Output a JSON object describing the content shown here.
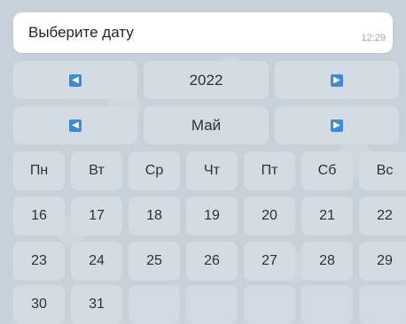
{
  "message": {
    "text": "Выберите дату",
    "time": "12:29"
  },
  "calendar": {
    "year": "2022",
    "month": "Май",
    "prev_icon": "left-arrow-icon",
    "next_icon": "right-arrow-icon",
    "weekdays": [
      "Пн",
      "Вт",
      "Ср",
      "Чт",
      "Пт",
      "Сб",
      "Вс"
    ],
    "weeks": [
      [
        "16",
        "17",
        "18",
        "19",
        "20",
        "21",
        "22"
      ],
      [
        "23",
        "24",
        "25",
        "26",
        "27",
        "28",
        "29"
      ],
      [
        "30",
        "31",
        "",
        "",
        "",
        "",
        ""
      ]
    ]
  },
  "colors": {
    "button_bg": "#d5dde4",
    "arrow_icon": "#3f8ad7",
    "message_bg": "#ffffff"
  }
}
